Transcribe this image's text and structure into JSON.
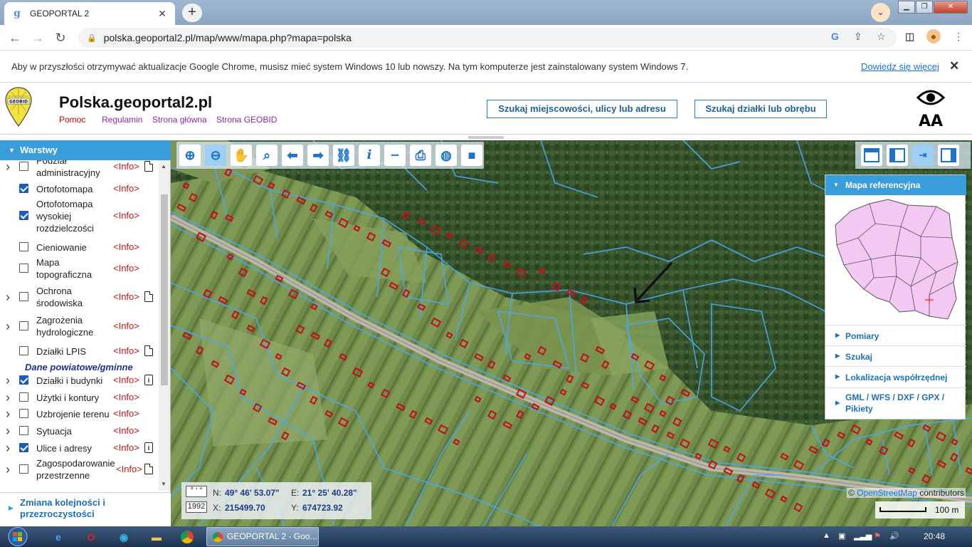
{
  "browser": {
    "tab_title": "GEOPORTAL 2",
    "tab_favicon": "g",
    "url": "polska.geoportal2.pl/map/www/mapa.php?mapa=polska",
    "infobar_message": "Aby w przyszłości otrzymywać aktualizacje Google Chrome, musisz mieć system Windows 10 lub nowszy. Na tym komputerze jest zainstalowany system Windows 7.",
    "infobar_link": "Dowiedz się więcej"
  },
  "site": {
    "title": "Polska.geoportal2.pl",
    "logo_text": "GEOBID",
    "links": [
      "Pomoc",
      "Regulamin",
      "Strona główna",
      "Strona GEOBID"
    ],
    "search_address_label": "Szukaj miejscowości, ulicy lub adresu",
    "search_parcel_label": "Szukaj działki lub obrębu",
    "font_size_label": "AA"
  },
  "sidebar": {
    "header": "Warstwy",
    "info_label": "<Info>",
    "group_header": "Dane powiatowe/gminne",
    "layers": [
      {
        "name": "Podział administracyjny",
        "checked": false,
        "expand": true,
        "icon": "doc"
      },
      {
        "name": "Ortofotomapa",
        "checked": true,
        "expand": false,
        "icon": ""
      },
      {
        "name": "Ortofotomapa wysokiej rozdzielczości",
        "checked": true,
        "expand": false,
        "icon": ""
      },
      {
        "name": "Cieniowanie",
        "checked": false,
        "expand": false,
        "icon": ""
      },
      {
        "name": "Mapa topograficzna",
        "checked": false,
        "expand": false,
        "icon": ""
      },
      {
        "name": "Ochrona środowiska",
        "checked": false,
        "expand": true,
        "icon": "doc"
      },
      {
        "name": "Zagrożenia hydrologiczne",
        "checked": false,
        "expand": true,
        "icon": ""
      },
      {
        "name": "Działki LPIS",
        "checked": false,
        "expand": false,
        "icon": "doc"
      },
      {
        "name": "Działki i budynki",
        "checked": true,
        "expand": true,
        "icon": "lock"
      },
      {
        "name": "Użytki i kontury",
        "checked": false,
        "expand": true,
        "icon": ""
      },
      {
        "name": "Uzbrojenie terenu",
        "checked": false,
        "expand": true,
        "icon": ""
      },
      {
        "name": "Sytuacja",
        "checked": false,
        "expand": true,
        "icon": ""
      },
      {
        "name": "Ulice i adresy",
        "checked": true,
        "expand": true,
        "icon": "lock"
      },
      {
        "name": "Zagospodarowanie przestrzenne",
        "checked": false,
        "expand": true,
        "icon": "doc"
      }
    ],
    "footer": "Zmiana kolejności i przezroczystości"
  },
  "map": {
    "tools": [
      "zoom-in",
      "zoom-out",
      "pan",
      "zoom-box",
      "back",
      "forward",
      "link",
      "info",
      "measure",
      "print",
      "globe",
      "video"
    ],
    "reference_panel": {
      "header": "Mapa referencyjna",
      "items": [
        "Pomiary",
        "Szukaj",
        "Lokalizacja współrzędnej",
        "GML / WFS / DXF / GPX / Pikiety"
      ]
    },
    "coords": {
      "format_btn": "° ' \"",
      "system_btn": "1992",
      "n_label": "N:",
      "n_value": "49° 46' 53.07\"",
      "e_label": "E:",
      "e_value": "21° 25' 40.28\"",
      "x_label": "X:",
      "x_value": "215499.70",
      "y_label": "Y:",
      "y_value": "674723.92"
    },
    "attribution_prefix": "©",
    "attribution_link": "OpenStreetMap",
    "attribution_suffix": "contributors",
    "scale_label": "100 m"
  },
  "taskbar": {
    "task_label": "GEOPORTAL 2 - Goo...",
    "clock": "20:48"
  },
  "colors": {
    "accent": "#3a9ddb",
    "info_red": "#c0181c",
    "parcel_line": "#4aa8f0",
    "building": "#c0101a"
  }
}
